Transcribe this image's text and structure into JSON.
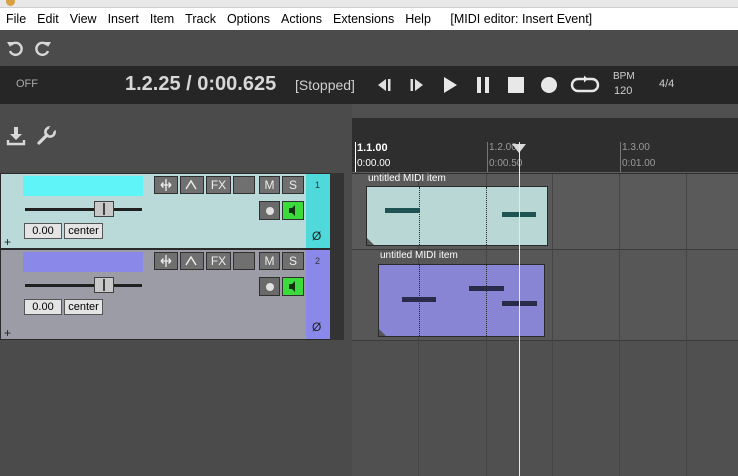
{
  "menu": {
    "items": [
      "File",
      "Edit",
      "View",
      "Insert",
      "Item",
      "Track",
      "Options",
      "Actions",
      "Extensions",
      "Help"
    ],
    "context": "[MIDI editor: Insert Event]"
  },
  "toolbar": {
    "icons": [
      "undo-icon",
      "redo-icon"
    ]
  },
  "transport": {
    "sync": "OFF",
    "position": "1.2.25 / 0:00.625",
    "state": "[Stopped]",
    "bpm_label": "BPM",
    "bpm_value": "120",
    "time_signature": "4/4",
    "controls": [
      "rewind-icon",
      "forward-icon",
      "play-icon",
      "pause-icon",
      "stop-icon",
      "record-icon",
      "loop-icon"
    ]
  },
  "ruler": {
    "measures": [
      {
        "bar": "1.1.00",
        "time": "0:00.00"
      },
      {
        "bar": "1.2.00",
        "time": "0:00.50"
      },
      {
        "bar": "1.3.00",
        "time": "0:01.00"
      }
    ]
  },
  "tracks": [
    {
      "number": "1",
      "color": "#5ff5f8",
      "panel_color": "#b9dad9",
      "side_color": "#4fd9db",
      "volume": "0.00",
      "pan": "center",
      "buttons": {
        "fx": "FX",
        "mute": "M",
        "solo": "S"
      },
      "phase": "Ø",
      "add": "+"
    },
    {
      "number": "2",
      "color": "#8a88e8",
      "panel_color": "#9c9ca7",
      "side_color": "#8a88e8",
      "volume": "0.00",
      "pan": "center",
      "buttons": {
        "fx": "FX",
        "mute": "M",
        "solo": "S"
      },
      "phase": "Ø",
      "add": "+"
    }
  ],
  "items": [
    {
      "label": "untitled MIDI item",
      "color": "#b9d8d5",
      "note_color": "#1f5252"
    },
    {
      "label": "untitled MIDI item",
      "color": "#8886d4",
      "note_color": "#2a2a4a"
    }
  ]
}
